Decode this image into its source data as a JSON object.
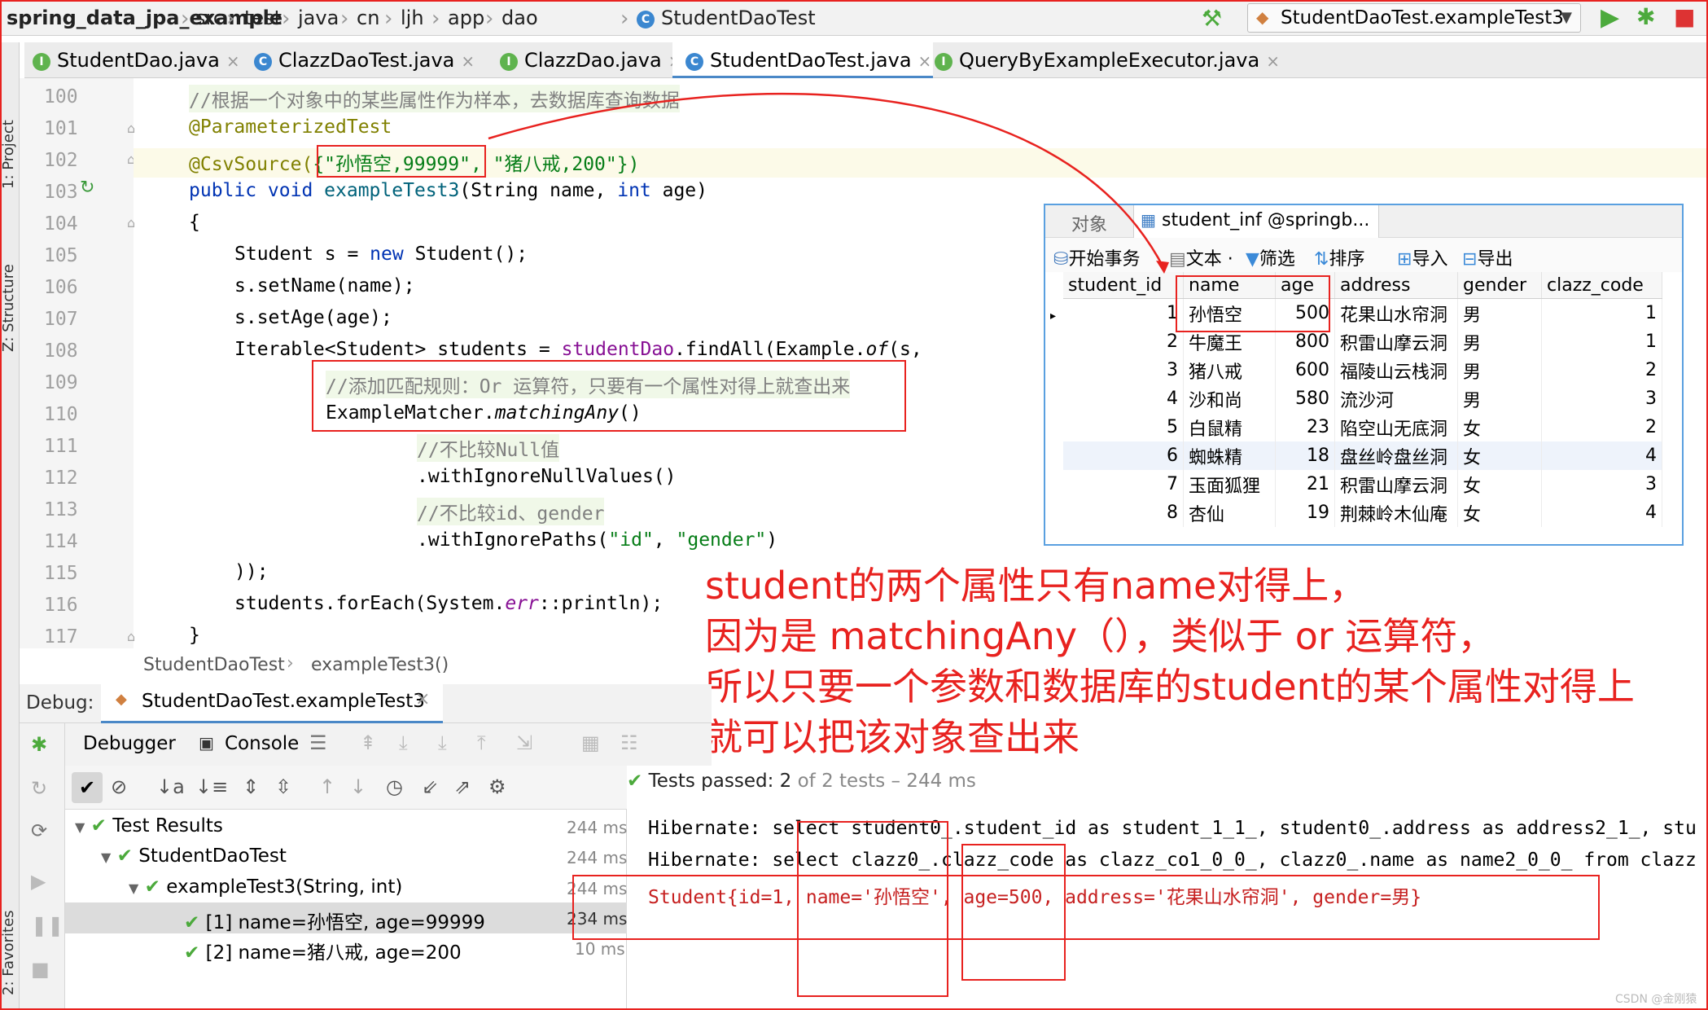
{
  "navbar": {
    "crumbs": [
      "spring_data_jpa_example",
      "src",
      "test",
      "java",
      "cn",
      "ljh",
      "app",
      "dao",
      "StudentDaoTest"
    ],
    "run_config": "StudentDaoTest.exampleTest3"
  },
  "tabs": [
    {
      "label": "StudentDao.java",
      "icon": "I"
    },
    {
      "label": "ClazzDaoTest.java",
      "icon": "C"
    },
    {
      "label": "ClazzDao.java",
      "icon": "I"
    },
    {
      "label": "StudentDaoTest.java",
      "icon": "C"
    },
    {
      "label": "QueryByExampleExecutor.java",
      "icon": "I"
    }
  ],
  "side_labels": {
    "project": "1: Project",
    "structure": "Z: Structure",
    "favorites": "2: Favorites"
  },
  "line_numbers": [
    "100",
    "101",
    "102",
    "103",
    "104",
    "105",
    "106",
    "107",
    "108",
    "109",
    "110",
    "111",
    "112",
    "113",
    "114",
    "115",
    "116",
    "117"
  ],
  "code": {
    "l100": "//根据一个对象中的某些属性作为样本，去数据库查询数据",
    "l101": "@ParameterizedTest",
    "l102a": "@CsvSource(",
    "l102b": "{\"孙悟空,99999\",",
    "l102c": " \"猪八戒,200\"})",
    "l103a": "public void ",
    "l103b": "exampleTest3",
    "l103c": "(String name, ",
    "l103d": "int",
    "l103e": " age)",
    "l104": "{",
    "l105a": "Student s = ",
    "l105b": "new",
    "l105c": " Student();",
    "l106": "s.setName(name);",
    "l107": "s.setAge(age);",
    "l108a": "Iterable<Student> students = ",
    "l108b": "studentDao",
    "l108c": ".findAll(Example.",
    "l108d": "of",
    "l108e": "(s,",
    "l109": "//添加匹配规则：Or 运算符，只要有一个属性对得上就查出来",
    "l110a": "ExampleMatcher.",
    "l110b": "matchingAny",
    "l110c": "()",
    "l111": "//不比较Null值",
    "l112": ".withIgnoreNullValues()",
    "l113": "//不比较id、gender",
    "l114a": ".withIgnorePaths(",
    "l114b": "\"id\"",
    "l114c": ", ",
    "l114d": "\"gender\"",
    "l114e": ")",
    "l115": "));",
    "l116a": "students.forEach(System.",
    "l116b": "err",
    "l116c": "::println);",
    "l117": "}"
  },
  "db": {
    "tab_objects": "对象",
    "tab_table": "student_inf @springb...",
    "toolbar": [
      "开始事务",
      "文本 ·",
      "筛选",
      "排序",
      "导入",
      "导出"
    ],
    "columns": [
      "student_id",
      "name",
      "age",
      "address",
      "gender",
      "clazz_code"
    ],
    "rows": [
      [
        "1",
        "孙悟空",
        "500",
        "花果山水帘洞",
        "男",
        "1"
      ],
      [
        "2",
        "牛魔王",
        "800",
        "积雷山摩云洞",
        "男",
        "1"
      ],
      [
        "3",
        "猪八戒",
        "600",
        "福陵山云栈洞",
        "男",
        "2"
      ],
      [
        "4",
        "沙和尚",
        "580",
        "流沙河",
        "男",
        "3"
      ],
      [
        "5",
        "白鼠精",
        "23",
        "陷空山无底洞",
        "女",
        "2"
      ],
      [
        "6",
        "蜘蛛精",
        "18",
        "盘丝岭盘丝洞",
        "女",
        "4"
      ],
      [
        "7",
        "玉面狐狸",
        "21",
        "积雷山摩云洞",
        "女",
        "3"
      ],
      [
        "8",
        "杏仙",
        "19",
        "荆棘岭木仙庵",
        "女",
        "4"
      ]
    ]
  },
  "note": {
    "line1": "student的两个属性只有name对得上，",
    "line2": "因为是 matchingAny（），类似于 or 运算符，",
    "line3": "所以只要一个参数和数据库的student的某个属性对得上",
    "line4": "就可以把该对象查出来"
  },
  "editor_crumb": {
    "cls": "StudentDaoTest",
    "method": "exampleTest3()"
  },
  "debug": {
    "label": "Debug:",
    "session": "StudentDaoTest.exampleTest3",
    "tab_debugger": "Debugger",
    "tab_console": "Console",
    "tests_passed": "Tests passed:",
    "tests_count": "2",
    "tests_rest": "of 2 tests – 244 ms"
  },
  "tree": [
    {
      "label": "Test Results",
      "time": "244 ms"
    },
    {
      "label": "StudentDaoTest",
      "time": "244 ms"
    },
    {
      "label": "exampleTest3(String, int)",
      "time": "244 ms"
    },
    {
      "label": "[1] name=孙悟空, age=99999",
      "time": "234 ms"
    },
    {
      "label": "[2] name=猪八戒, age=200",
      "time": "10 ms"
    }
  ],
  "console": {
    "line1": "Hibernate: select student0_.student_id as student_1_1_, student0_.address as address2_1_, stu",
    "line2": "Hibernate: select clazz0_.clazz_code as clazz_co1_0_0_, clazz0_.name as name2_0_0_ from clazz",
    "line3": "Student{id=1, name='孙悟空', age=500, address='花果山水帘洞', gender=男}"
  },
  "watermark": "CSDN @金刚猿",
  "colors": {
    "annotation_red": "#e8221f",
    "accent_blue": "#4a88c7",
    "pass_green": "#4caa3c"
  }
}
